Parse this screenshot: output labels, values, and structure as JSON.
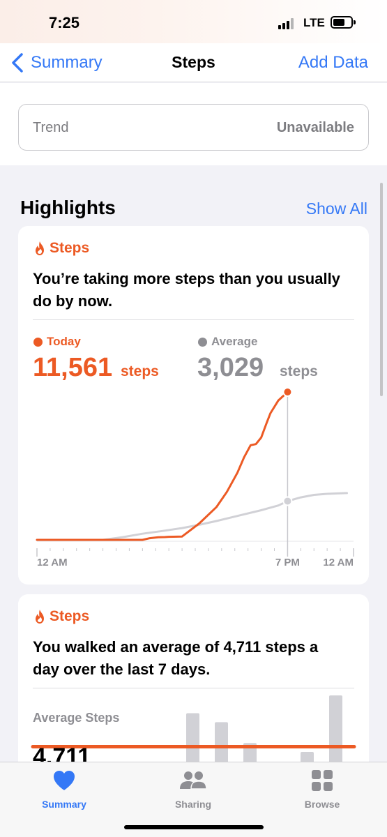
{
  "status": {
    "time": "7:25",
    "network": "LTE"
  },
  "nav": {
    "back_label": "Summary",
    "title": "Steps",
    "add_label": "Add Data"
  },
  "trend": {
    "label": "Trend",
    "value": "Unavailable"
  },
  "highlights": {
    "title": "Highlights",
    "show_all": "Show All",
    "cards": [
      {
        "category": "Steps",
        "message": "You’re taking more steps than you usually do by now.",
        "today_label": "Today",
        "today_value": "11,561",
        "today_unit": "steps",
        "average_label": "Average",
        "average_value": "3,029",
        "average_unit": "steps",
        "x_labels": [
          "12 AM",
          "7 PM",
          "12 AM"
        ]
      },
      {
        "category": "Steps",
        "message": "You walked an average of 4,711 steps a day over the last 7 days.",
        "avg_label": "Average Steps",
        "avg_value": "4,711"
      }
    ]
  },
  "chart_data": [
    {
      "type": "line",
      "x_unit": "hour of day",
      "x_ticks": [
        "12 AM",
        "7 PM",
        "12 AM"
      ],
      "xlim": [
        0,
        24
      ],
      "series": [
        {
          "name": "Today",
          "color": "#ec5a24",
          "x": [
            0,
            3,
            6,
            8,
            8.5,
            9.2,
            9.7,
            10,
            11,
            12.3,
            13.6,
            14.4,
            15.2,
            15.7,
            16.2,
            16.6,
            17,
            17.4,
            17.7,
            18.3,
            19
          ],
          "y": [
            0,
            0,
            0,
            0,
            120,
            200,
            220,
            240,
            260,
            1280,
            2560,
            3750,
            5250,
            6450,
            7400,
            7490,
            8000,
            9100,
            9900,
            10900,
            11561
          ]
        },
        {
          "name": "Average",
          "color": "#d1d1d6",
          "x": [
            0,
            5,
            6.5,
            8,
            9.5,
            11,
            12.3,
            13.6,
            15.2,
            17,
            18.3,
            19,
            20,
            21,
            22,
            23.5
          ],
          "y": [
            0,
            0,
            210,
            480,
            690,
            920,
            1180,
            1470,
            1870,
            2320,
            2690,
            3029,
            3320,
            3520,
            3600,
            3660
          ]
        }
      ]
    },
    {
      "type": "bar",
      "title": "Average Steps",
      "average_line": 4711,
      "values": [
        6300,
        5700,
        4300,
        0,
        0,
        3700,
        7500
      ],
      "color": "#d1d1d6"
    }
  ],
  "tabs": [
    {
      "label": "Summary",
      "icon": "heart-icon",
      "active": true
    },
    {
      "label": "Sharing",
      "icon": "people-icon",
      "active": false
    },
    {
      "label": "Browse",
      "icon": "grid-icon",
      "active": false
    }
  ],
  "colors": {
    "accent": "#3478f6",
    "steps": "#ec5a24",
    "average": "#8e8e93"
  }
}
